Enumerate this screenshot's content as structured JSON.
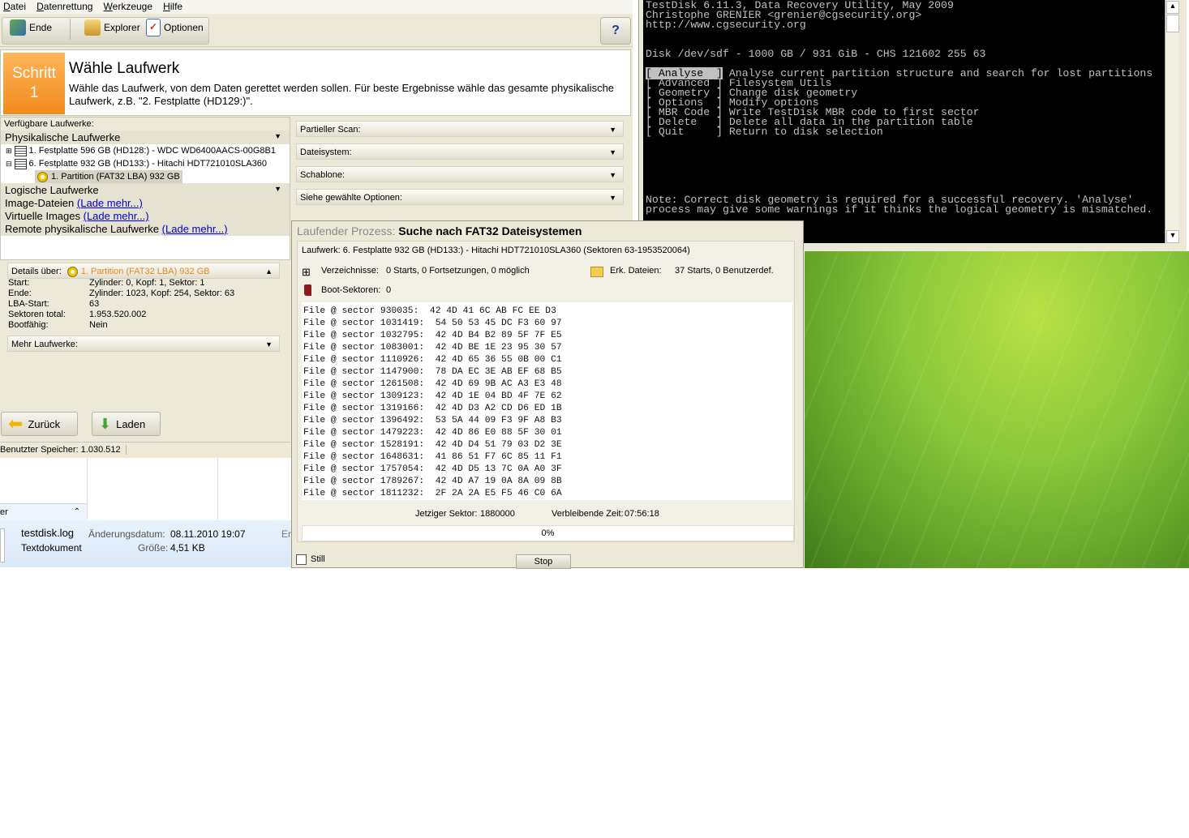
{
  "menu": [
    "Datei",
    "Datenrettung",
    "Werkzeuge",
    "Hilfe"
  ],
  "toolbar": {
    "exit_label": "Ende",
    "explorer_label": "Explorer",
    "options_label": "Optionen"
  },
  "step": {
    "box_word": "Schritt",
    "box_number": "1",
    "title": "Wähle Laufwerk",
    "description": "Wähle das Laufwerk, von dem Daten gerettet werden sollen. Für beste Ergebnisse wähle das gesamte physikalische Laufwerk, z.B. \"2. Festplatte (HD129:)\"."
  },
  "drives": {
    "header": "Verfügbare Laufwerke:",
    "physical_label": "Physikalische Laufwerke",
    "disk1": "1. Festplatte 596 GB (HD128:) - WDC WD6400AACS-00G8B1",
    "disk6": "6. Festplatte 932 GB (HD133:) - Hitachi HDT721010SLA360",
    "partition": "1. Partition (FAT32 LBA) 932 GB",
    "logical_label": "Logische Laufwerke",
    "image_files": "Image-Dateien",
    "virtual_images": "Virtuelle Images",
    "remote_drives": "Remote physikalische Laufwerke",
    "load_more": "(Lade mehr...)"
  },
  "options": {
    "partial_scan": "Partieller Scan:",
    "filesystem": "Dateisystem:",
    "template": "Schablone:",
    "selected_options": "Siehe gewählte Optionen:"
  },
  "details": {
    "header": "Details über:",
    "selected": "1. Partition (FAT32 LBA) 932 GB",
    "rows": [
      {
        "label": "Start:",
        "value": "Zylinder: 0, Kopf: 1, Sektor: 1"
      },
      {
        "label": "Ende:",
        "value": "Zylinder: 1023, Kopf: 254, Sektor: 63"
      },
      {
        "label": "LBA-Start:",
        "value": "63"
      },
      {
        "label": "Sektoren total:",
        "value": "1.953.520.002"
      },
      {
        "label": "Bootfähig:",
        "value": "Nein"
      }
    ],
    "more_drives": "Mehr Laufwerke:"
  },
  "buttons": {
    "back": "Zurück",
    "load": "Laden"
  },
  "status": {
    "memory": "Benutzter Speicher: 1.030.512"
  },
  "explorer": {
    "partial_text": "er",
    "file_name": "testdisk.log",
    "file_type": "Textdokument",
    "modified_label": "Änderungsdatum:",
    "modified_value": "08.11.2010 19:07",
    "size_label": "Größe:",
    "size_value": "4,51 KB",
    "cut_label": "Ers"
  },
  "terminal": {
    "lines": [
      "TestDisk 6.11.3, Data Recovery Utility, May 2009",
      "Christophe GRENIER <grenier@cgsecurity.org>",
      "http://www.cgsecurity.org",
      "",
      "",
      "Disk /dev/sdf - 1000 GB / 931 GiB - CHS 121602 255 63",
      "",
      "",
      "",
      "",
      "",
      "",
      "",
      "",
      "",
      "",
      "",
      "",
      "",
      "",
      "Note: Correct disk geometry is required for a successful recovery. 'Analyse'",
      "process may give some warnings if it thinks the logical geometry is mismatched."
    ],
    "menu": [
      {
        "key": "[ Analyse  ]",
        "desc": "Analyse current partition structure and search for lost partitions"
      },
      {
        "key": "[ Advanced ]",
        "desc": "Filesystem Utils"
      },
      {
        "key": "[ Geometry ]",
        "desc": "Change disk geometry"
      },
      {
        "key": "[ Options  ]",
        "desc": "Modify options"
      },
      {
        "key": "[ MBR Code ]",
        "desc": "Write TestDisk MBR code to first sector"
      },
      {
        "key": "[ Delete   ]",
        "desc": "Delete all data in the partition table"
      },
      {
        "key": "[ Quit     ]",
        "desc": "Return to disk selection"
      }
    ]
  },
  "dialog": {
    "title_prefix": "Laufender Prozess:",
    "title": "Suche nach FAT32 Dateisystemen",
    "drive_info": "Laufwerk: 6. Festplatte 932 GB (HD133:) - Hitachi HDT721010SLA360 (Sektoren 63-1953520064)",
    "dirs_label": "Verzeichnisse:",
    "dirs_value": "0 Starts, 0 Fortsetzungen, 0 möglich",
    "files_label": "Erk. Dateien:",
    "files_value": "37 Starts, 0 Benutzerdef.",
    "boot_label": "Boot-Sektoren:",
    "boot_value": "0",
    "log": [
      "File @ sector 930035:  42 4D 41 6C AB FC EE D3",
      "File @ sector 1031419:  54 50 53 45 DC F3 60 97",
      "File @ sector 1032795:  42 4D B4 B2 89 5F 7F E5",
      "File @ sector 1083001:  42 4D BE 1E 23 95 30 57",
      "File @ sector 1110926:  42 4D 65 36 55 0B 00 C1",
      "File @ sector 1147900:  78 DA EC 3E AB EF 68 B5",
      "File @ sector 1261508:  42 4D 69 9B AC A3 E3 48",
      "File @ sector 1309123:  42 4D 1E 04 BD 4F 7E 62",
      "File @ sector 1319166:  42 4D D3 A2 CD D6 ED 1B",
      "File @ sector 1396492:  53 5A 44 09 F3 9F A8 B3",
      "File @ sector 1479223:  42 4D 86 E0 88 5F 30 01",
      "File @ sector 1528191:  42 4D D4 51 79 03 D2 3E",
      "File @ sector 1648631:  41 86 51 F7 6C 85 11 F1",
      "File @ sector 1757054:  42 4D D5 13 7C 0A A0 3F",
      "File @ sector 1789267:  42 4D A7 19 0A 8A 09 8B",
      "File @ sector 1811232:  2F 2A 2A E5 F5 46 C0 6A"
    ],
    "current_sector_label": "Jetziger Sektor:",
    "current_sector_value": "1880000",
    "remaining_label": "Verbleibende Zeit:",
    "remaining_value": "07:56:18",
    "progress_label": "0%",
    "progress_fraction": 0,
    "still_label": "Still",
    "stop_label": "Stop"
  }
}
